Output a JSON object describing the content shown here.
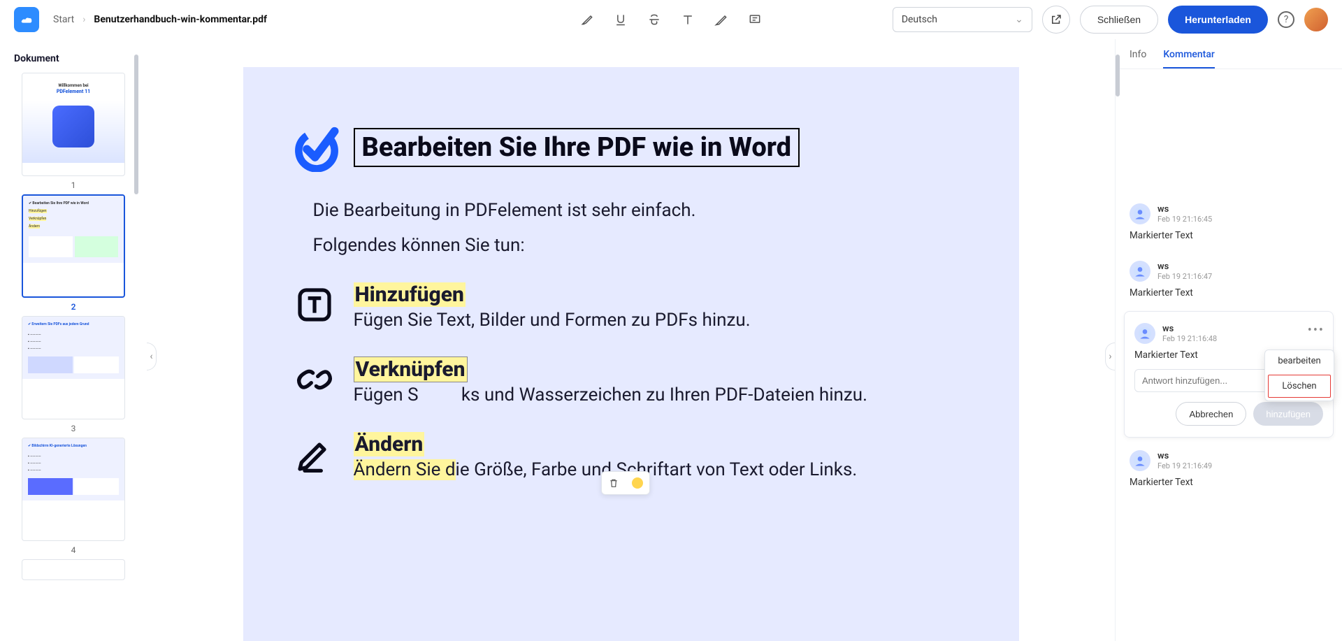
{
  "header": {
    "breadcrumb_start": "Start",
    "breadcrumb_file": "Benutzerhandbuch-win-kommentar.pdf",
    "language": "Deutsch",
    "close_label": "Schließen",
    "download_label": "Herunterladen"
  },
  "sidebar": {
    "title": "Dokument",
    "thumbs": [
      {
        "num": "1"
      },
      {
        "num": "2"
      },
      {
        "num": "3"
      },
      {
        "num": "4"
      }
    ]
  },
  "page": {
    "h1": "Bearbeiten Sie Ihre PDF wie in Word",
    "line1": "Die Bearbeitung in PDFelement ist sehr einfach.",
    "line2": "Folgendes können Sie tun:",
    "items": [
      {
        "title": "Hinzufügen",
        "desc": "Fügen Sie Text, Bilder und Formen zu PDFs hinzu."
      },
      {
        "title": "Verknüpfen",
        "desc_pre": "Fügen S",
        "desc_post": "ks und Wasserzeichen zu Ihren PDF-Dateien hinzu."
      },
      {
        "title": "Ändern",
        "desc_hl": "Ändern Sie d",
        "desc_post": "ie Größe, Farbe und Schriftart von Text oder Links."
      }
    ]
  },
  "right": {
    "tab_info": "Info",
    "tab_comment": "Kommentar",
    "reply_placeholder": "Antwort hinzufügen...",
    "cancel": "Abbrechen",
    "add": "hinzufügen",
    "menu_edit": "bearbeiten",
    "menu_delete": "Löschen",
    "comments": [
      {
        "user": "ws",
        "time": "Feb 19 21:16:45",
        "text": "Markierter Text"
      },
      {
        "user": "ws",
        "time": "Feb 19 21:16:47",
        "text": "Markierter Text"
      },
      {
        "user": "ws",
        "time": "Feb 19 21:16:48",
        "text": "Markierter Text"
      },
      {
        "user": "ws",
        "time": "Feb 19 21:16:49",
        "text": "Markierter Text"
      }
    ]
  }
}
